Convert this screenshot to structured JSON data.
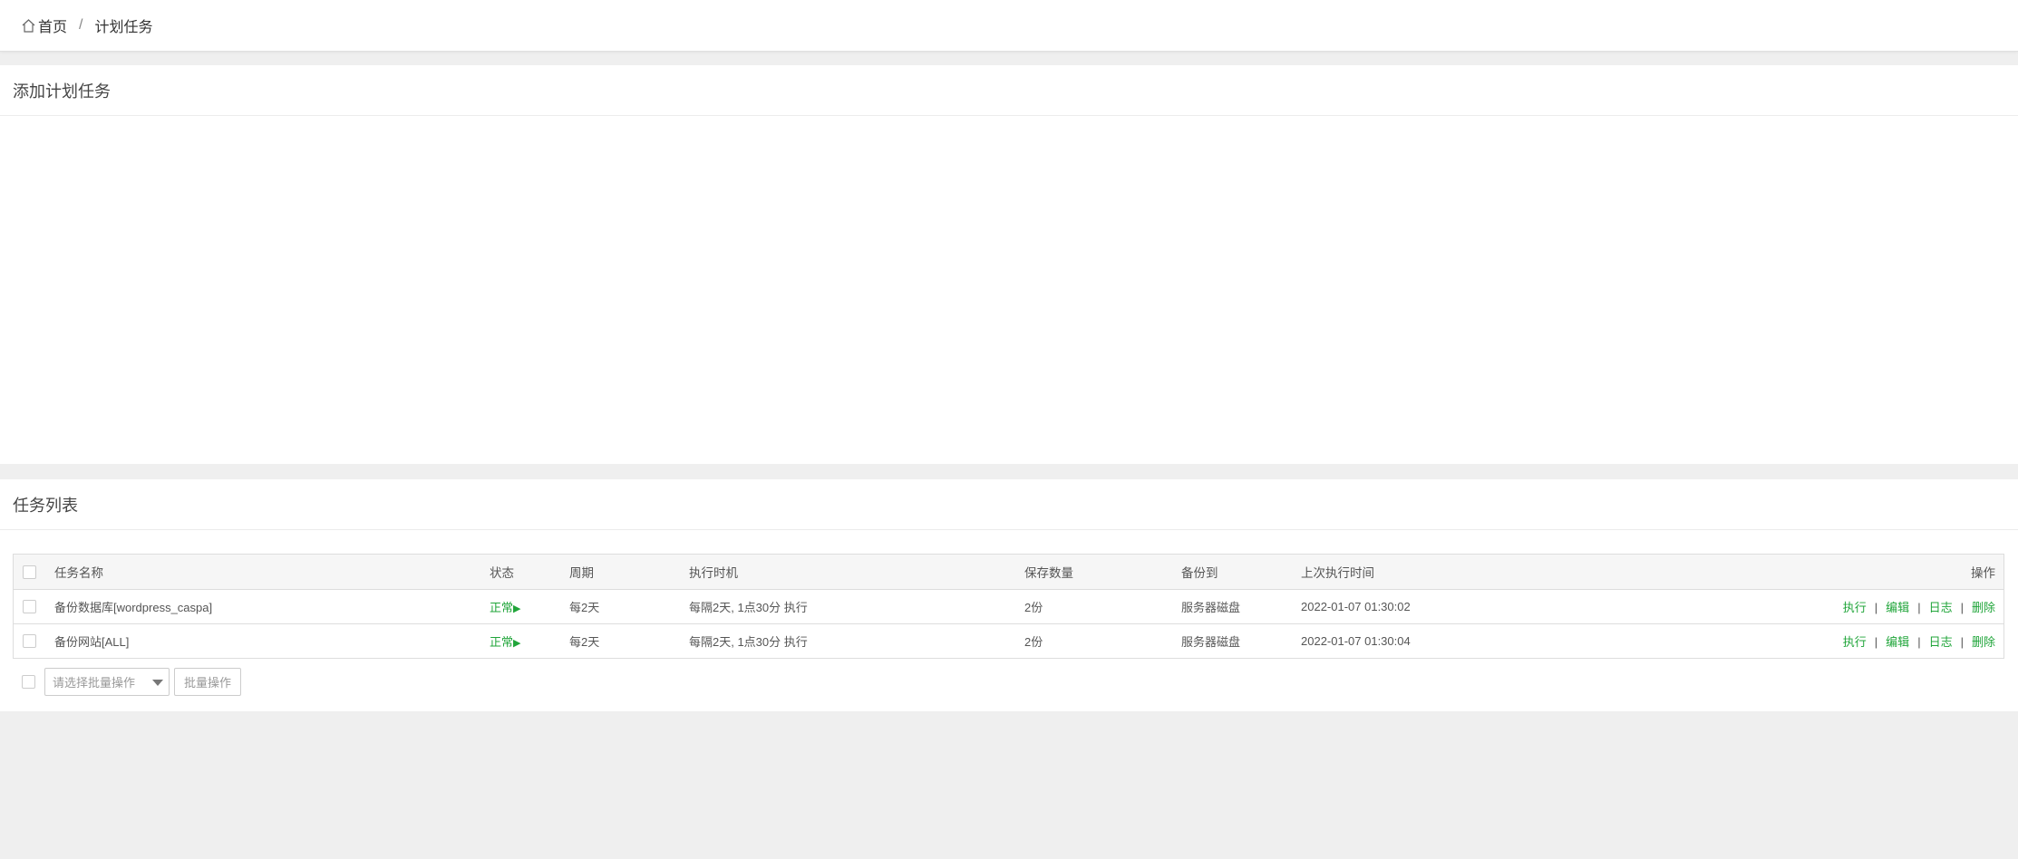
{
  "breadcrumb": {
    "home": "首页",
    "separator": "/",
    "current": "计划任务"
  },
  "add_panel": {
    "title": "添加计划任务"
  },
  "list_panel": {
    "title": "任务列表"
  },
  "table": {
    "headers": [
      "任务名称",
      "状态",
      "周期",
      "执行时机",
      "保存数量",
      "备份到",
      "上次执行时间",
      "操作"
    ],
    "rows": [
      {
        "name": "备份数据库[wordpress_caspa]",
        "status": "正常",
        "status_icon": "▶",
        "cycle": "每2天",
        "timing": "每隔2天, 1点30分 执行",
        "keep": "2份",
        "backup_to": "服务器磁盘",
        "last_run": "2022-01-07 01:30:02"
      },
      {
        "name": "备份网站[ALL]",
        "status": "正常",
        "status_icon": "▶",
        "cycle": "每2天",
        "timing": "每隔2天, 1点30分 执行",
        "keep": "2份",
        "backup_to": "服务器磁盘",
        "last_run": "2022-01-07 01:30:04"
      }
    ],
    "ops": {
      "run": "执行",
      "edit": "编辑",
      "log": "日志",
      "delete": "删除",
      "sep": "|"
    }
  },
  "batch": {
    "placeholder": "请选择批量操作",
    "button": "批量操作"
  },
  "colors": {
    "accent": "#20a53a",
    "background": "#efefef"
  }
}
